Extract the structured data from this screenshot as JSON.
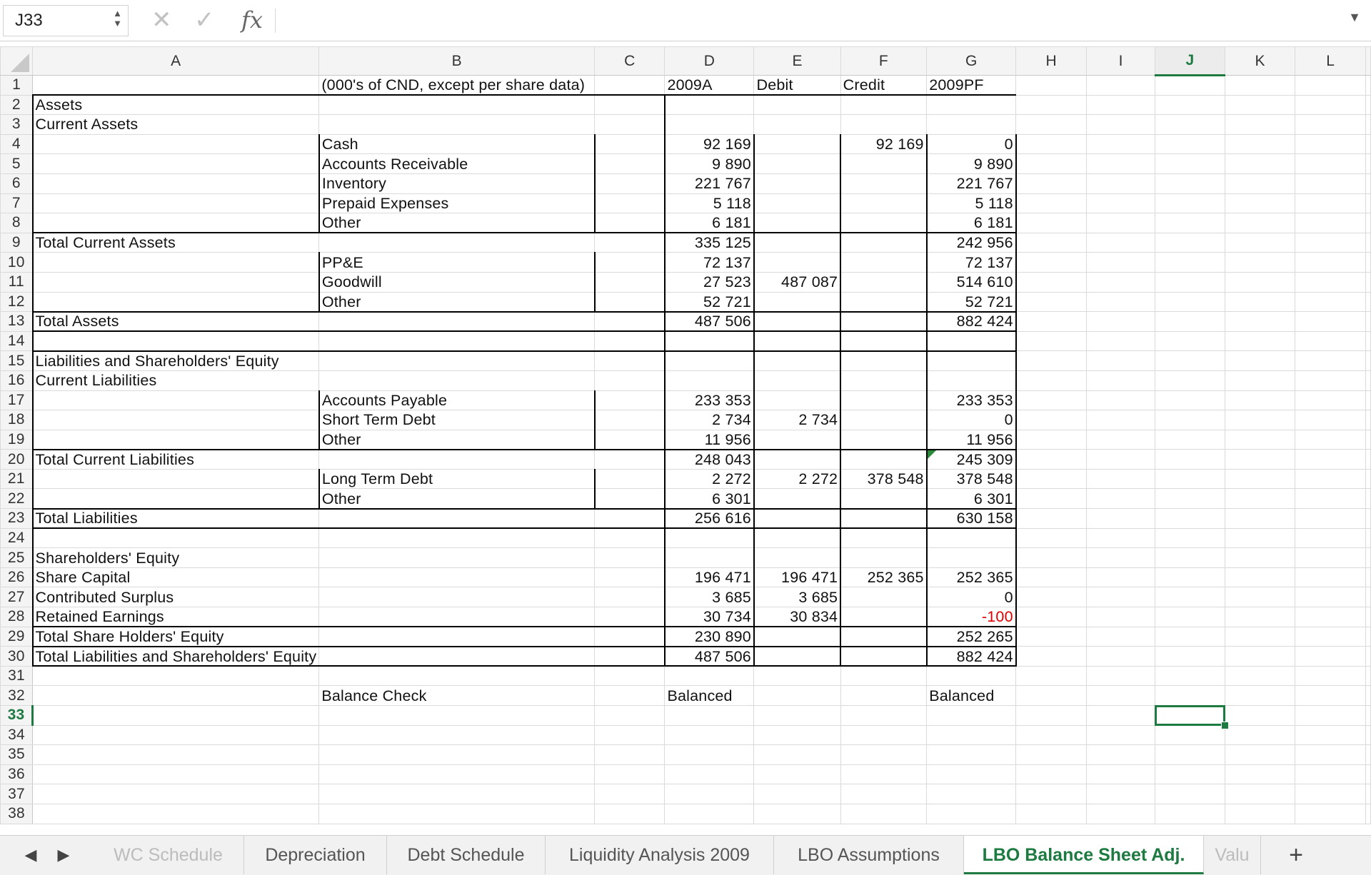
{
  "name_box": "J33",
  "formula_icons": {
    "cancel": "✕",
    "enter": "✓",
    "fx": "fx"
  },
  "columns": [
    "A",
    "B",
    "C",
    "D",
    "E",
    "F",
    "G",
    "H",
    "I",
    "J",
    "K",
    "L"
  ],
  "selected_column": "J",
  "selected_row": 33,
  "rows": [
    {
      "n": 1,
      "B": "(000's of CND, except per share data)",
      "D": "2009A",
      "E": "Debit",
      "F": "Credit",
      "G": "2009PF"
    },
    {
      "n": 2,
      "A": "Assets"
    },
    {
      "n": 3,
      "A": "Current Assets"
    },
    {
      "n": 4,
      "B": "Cash",
      "D": "92 169",
      "F": "92 169",
      "G": "0"
    },
    {
      "n": 5,
      "B": "Accounts Receivable",
      "D": "9 890",
      "G": "9 890"
    },
    {
      "n": 6,
      "B": "Inventory",
      "D": "221 767",
      "G": "221 767"
    },
    {
      "n": 7,
      "B": "Prepaid Expenses",
      "D": "5 118",
      "G": "5 118"
    },
    {
      "n": 8,
      "B": "Other",
      "D": "6 181",
      "G": "6 181"
    },
    {
      "n": 9,
      "A": "Total Current Assets",
      "D": "335 125",
      "G": "242 956"
    },
    {
      "n": 10,
      "B": "PP&E",
      "D": "72 137",
      "G": "72 137"
    },
    {
      "n": 11,
      "B": "Goodwill",
      "D": "27 523",
      "E": "487 087",
      "G": "514 610"
    },
    {
      "n": 12,
      "B": "Other",
      "D": "52 721",
      "G": "52 721"
    },
    {
      "n": 13,
      "A": "Total Assets",
      "D": "487 506",
      "G": "882 424"
    },
    {
      "n": 14
    },
    {
      "n": 15,
      "A": "Liabilities and Shareholders' Equity"
    },
    {
      "n": 16,
      "A": "Current Liabilities"
    },
    {
      "n": 17,
      "B": "Accounts Payable",
      "D": "233 353",
      "G": "233 353"
    },
    {
      "n": 18,
      "B": "Short Term Debt",
      "D": "2 734",
      "E": "2 734",
      "G": "0"
    },
    {
      "n": 19,
      "B": "Other",
      "D": "11 956",
      "G": "11 956"
    },
    {
      "n": 20,
      "A": "Total Current Liabilities",
      "D": "248 043",
      "G": "245 309"
    },
    {
      "n": 21,
      "B": "Long Term Debt",
      "D": "2 272",
      "E": "2 272",
      "F": "378 548",
      "G": "378 548"
    },
    {
      "n": 22,
      "B": "Other",
      "D": "6 301",
      "G": "6 301"
    },
    {
      "n": 23,
      "A": "Total Liabilities",
      "D": "256 616",
      "G": "630 158"
    },
    {
      "n": 24
    },
    {
      "n": 25,
      "A": "Shareholders' Equity"
    },
    {
      "n": 26,
      "A": "Share Capital",
      "D": "196 471",
      "E": "196 471",
      "F": "252 365",
      "G": "252 365"
    },
    {
      "n": 27,
      "A": "Contributed Surplus",
      "D": "3 685",
      "E": "3 685",
      "G": "0"
    },
    {
      "n": 28,
      "A": "Retained Earnings",
      "D": "30 734",
      "E": "30 834",
      "G": "-100"
    },
    {
      "n": 29,
      "A": "Total Share Holders' Equity",
      "D": "230 890",
      "G": "252 265"
    },
    {
      "n": 30,
      "A": "Total Liabilities and Shareholders' Equity",
      "D": "487 506",
      "G": "882 424"
    },
    {
      "n": 31
    },
    {
      "n": 32,
      "B": "Balance Check",
      "D": "Balanced",
      "G": "Balanced"
    },
    {
      "n": 33
    },
    {
      "n": 34
    },
    {
      "n": 35
    },
    {
      "n": 36
    },
    {
      "n": 37
    },
    {
      "n": 38
    }
  ],
  "sheet_tabs": [
    {
      "label": "WC Schedule",
      "active": false
    },
    {
      "label": "Depreciation",
      "active": false
    },
    {
      "label": "Debt Schedule",
      "active": false
    },
    {
      "label": "Liquidity Analysis 2009",
      "active": false
    },
    {
      "label": "LBO Assumptions",
      "active": false
    },
    {
      "label": "LBO Balance Sheet Adj.",
      "active": true
    },
    {
      "label": "Valu",
      "active": false
    }
  ],
  "add_sheet_label": "+",
  "colors": {
    "accent": "#1d7a41",
    "negative": "#e00000"
  }
}
